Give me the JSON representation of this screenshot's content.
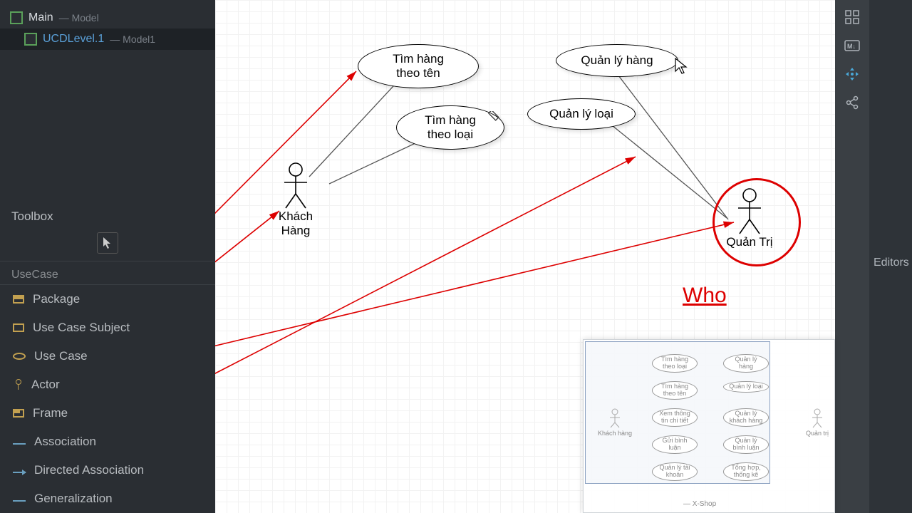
{
  "tree": {
    "main": {
      "name": "Main",
      "sub": "— Model"
    },
    "child": {
      "name": "UCDLevel.1",
      "sub": "— Model1"
    }
  },
  "toolbox": {
    "header": "Toolbox",
    "category": "UseCase",
    "items": [
      "Package",
      "Use Case Subject",
      "Use Case",
      "Actor",
      "Frame",
      "Association",
      "Directed Association",
      "Generalization"
    ]
  },
  "diagram": {
    "usecases": {
      "uc1": "Tìm hàng\ntheo tên",
      "uc2": "Tìm hàng\ntheo loại",
      "uc3": "Quản lý hàng",
      "uc4": "Quản lý loại"
    },
    "actors": {
      "a1": "Khách Hàng",
      "a2": "Quản Trị"
    },
    "annotation": "Who"
  },
  "minimap": {
    "left_actor": "Khách hàng",
    "right_actor": "Quản trị",
    "footer": "— X-Shop",
    "ovals": {
      "l1": "Tìm hàng theo loại",
      "l2": "Tìm hàng theo tên",
      "l3": "Xem thông tin chi tiết",
      "l4": "Gửi bình luận",
      "l5": "Quản lý tài khoản",
      "r1": "Quản lý hàng",
      "r2": "Quản lý loại",
      "r3": "Quản lý khách hàng",
      "r4": "Quản lý bình luận",
      "r5": "Tổng hợp, thống kê"
    }
  },
  "right_panel": {
    "editors": "Editors"
  }
}
